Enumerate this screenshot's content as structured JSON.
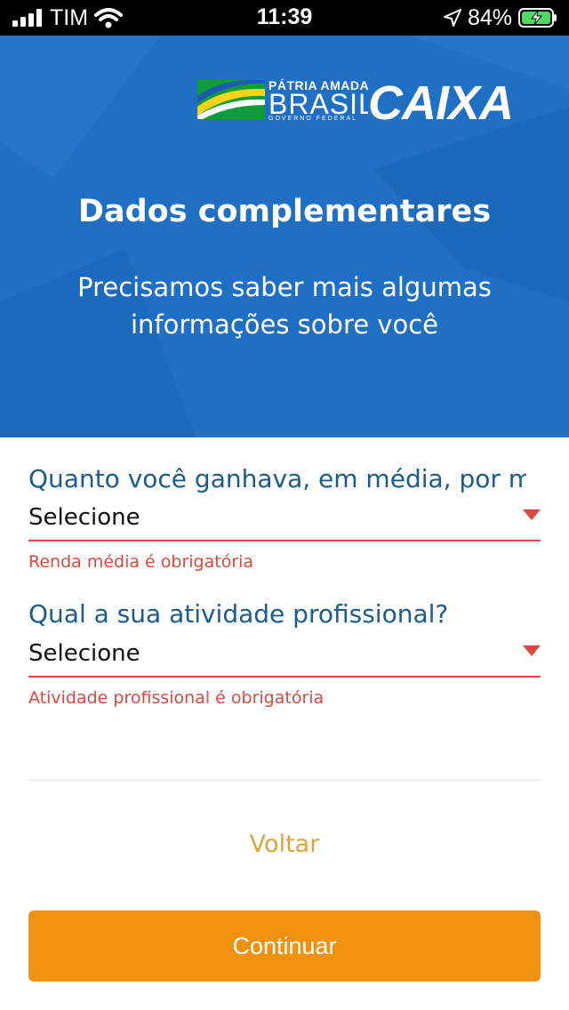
{
  "status_bar": {
    "carrier": "TIM",
    "time": "11:39",
    "battery_percent": "84%"
  },
  "header": {
    "brand_patria_top": "PÁTRIA AMADA",
    "brand_patria_main": "BRASIL",
    "brand_patria_bottom": "GOVERNO FEDERAL",
    "brand_caixa": "CAIXA",
    "title": "Dados complementares",
    "subtitle": "Precisamos saber mais algumas informações sobre você"
  },
  "form": {
    "income": {
      "label": "Quanto você ganhava, em média, por mê…",
      "value": "Selecione",
      "error": "Renda média é obrigatória"
    },
    "occupation": {
      "label": "Qual a sua atividade profissional?",
      "value": "Selecione",
      "error": "Atividade profissional é obrigatória"
    }
  },
  "actions": {
    "back_label": "Voltar",
    "continue_label": "Continuar"
  },
  "colors": {
    "header_blue": "#1f6fc4",
    "label_blue": "#1a5c8a",
    "error_red": "#d9493f",
    "button_orange": "#f0920e",
    "link_gold": "#dca436"
  }
}
